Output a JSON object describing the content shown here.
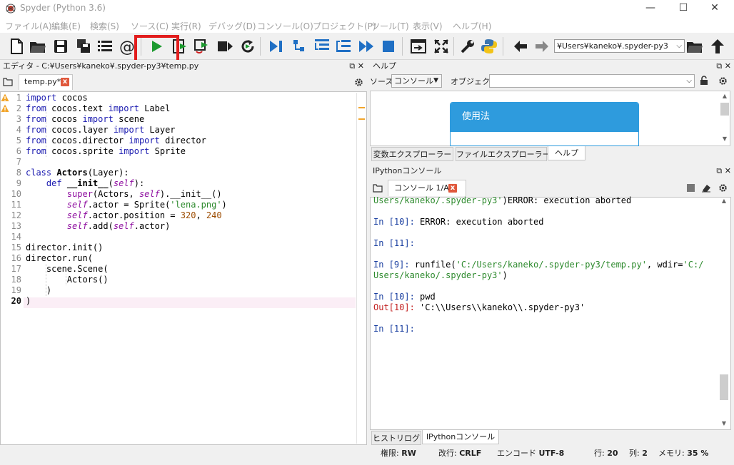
{
  "window": {
    "title": "Spyder (Python 3.6)",
    "controls": {
      "minimize": "—",
      "maximize": "☐",
      "close": "✕"
    }
  },
  "menu": [
    "ファイル(A)",
    "編集(E)",
    "検索(S)",
    "ソース(C)",
    "実行(R)",
    "デバッグ(D)",
    "コンソール(O)",
    "プロジェクト(P)",
    "ツール(T)",
    "表示(V)",
    "ヘルプ(H)"
  ],
  "toolbar": {
    "working_dir": "¥Users¥kaneko¥.spyder-py3",
    "highlighted_button": "run-file-button"
  },
  "editor": {
    "header": "エディタ - C:¥Users¥kaneko¥.spyder-py3¥temp.py",
    "tab_label": "temp.py*",
    "tab_close": "x",
    "current_line": 20,
    "warning_lines": [
      1,
      2
    ],
    "line_numbers": [
      "1",
      "2",
      "3",
      "4",
      "5",
      "6",
      "7",
      "8",
      "9",
      "10",
      "11",
      "12",
      "13",
      "14",
      "15",
      "16",
      "17",
      "18",
      "19",
      "20"
    ],
    "code": [
      "import cocos",
      "from cocos.text import Label",
      "from cocos import scene",
      "from cocos.layer import Layer",
      "from cocos.director import director",
      "from cocos.sprite import Sprite",
      "",
      "class Actors(Layer):",
      "    def __init__(self):",
      "        super(Actors, self).__init__()",
      "        self.actor = Sprite('lena.png')",
      "        self.actor.position = 320, 240",
      "        self.add(self.actor)",
      "",
      "director.init()",
      "director.run(",
      "    scene.Scene(",
      "        Actors()",
      "    )",
      ")"
    ]
  },
  "help": {
    "header": "ヘルプ",
    "source_label": "ソース",
    "source_value": "コンソール",
    "object_label": "オブジェクト",
    "usage_title": "使用法",
    "bottom_tabs": [
      "変数エクスプローラー",
      "ファイルエクスプローラー",
      "ヘルプ"
    ],
    "active_tab": "ヘルプ"
  },
  "console": {
    "header": "IPythonコンソール",
    "tab_label": "コンソール 1/A",
    "tab_close": "x",
    "lines": {
      "l1_str": "Users/kaneko/.spyder-py3'",
      "l1_rest": ")ERROR: execution aborted",
      "l2_prompt": "In [10]:",
      "l2_rest": " ERROR: execution aborted",
      "l3_prompt": "In [11]:",
      "l4_prompt": "In [9]:",
      "l4_cmd": " runfile(",
      "l4_str1": "'C:/Users/kaneko/.spyder-py3/temp.py'",
      "l4_mid": ", wdir=",
      "l4_str2": "'C:/",
      "l5_str": "Users/kaneko/.spyder-py3'",
      "l5_rest": ")",
      "l6_prompt": "In [10]:",
      "l6_rest": " pwd",
      "l7_out": "Out[10]:",
      "l7_rest": " 'C:\\\\Users\\\\kaneko\\\\.spyder-py3'",
      "l8_prompt": "In [11]:"
    },
    "bottom_tabs": [
      "ヒストリログ",
      "IPythonコンソール"
    ],
    "active_tab": "IPythonコンソール"
  },
  "status": {
    "perm_label": "権限:",
    "perm_value": "RW",
    "eol_label": "改行:",
    "eol_value": "CRLF",
    "enc_label": "エンコード",
    "enc_value": "UTF-8",
    "line_label": "行:",
    "line_value": "20",
    "col_label": "列:",
    "col_value": "2",
    "mem_label": "メモリ:",
    "mem_value": "35 %"
  }
}
